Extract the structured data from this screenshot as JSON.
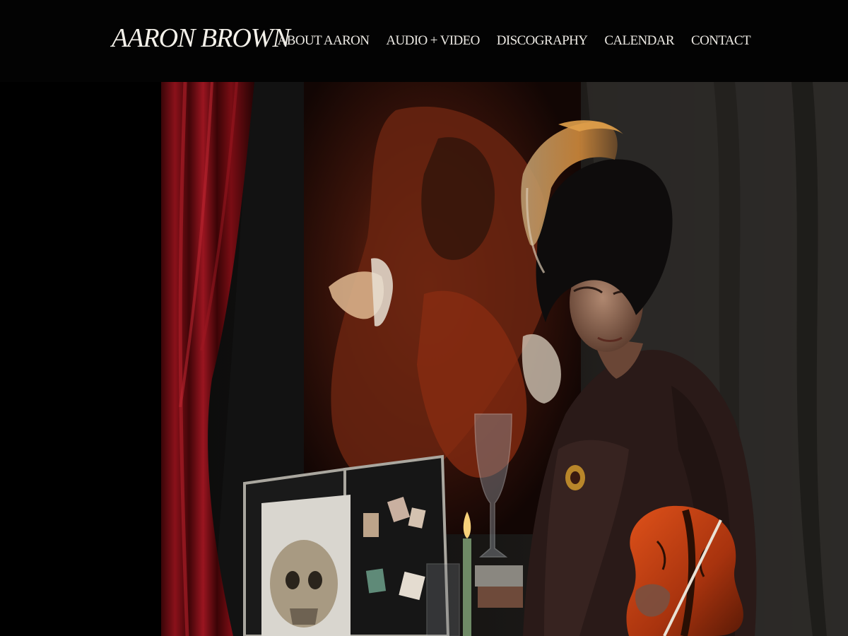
{
  "site": {
    "logo_text": "AARON BROWN"
  },
  "nav": {
    "items": [
      {
        "label": "ABOUT AARON"
      },
      {
        "label": "AUDIO + VIDEO"
      },
      {
        "label": "DISCOGRAPHY"
      },
      {
        "label": "CALENDAR"
      },
      {
        "label": "CONTACT"
      }
    ]
  },
  "colors": {
    "background": "#000000",
    "header_text": "#ece9e3",
    "curtain_red": "#7a0d12"
  },
  "hero": {
    "image_semantic": "violinist-portrait-photo"
  }
}
